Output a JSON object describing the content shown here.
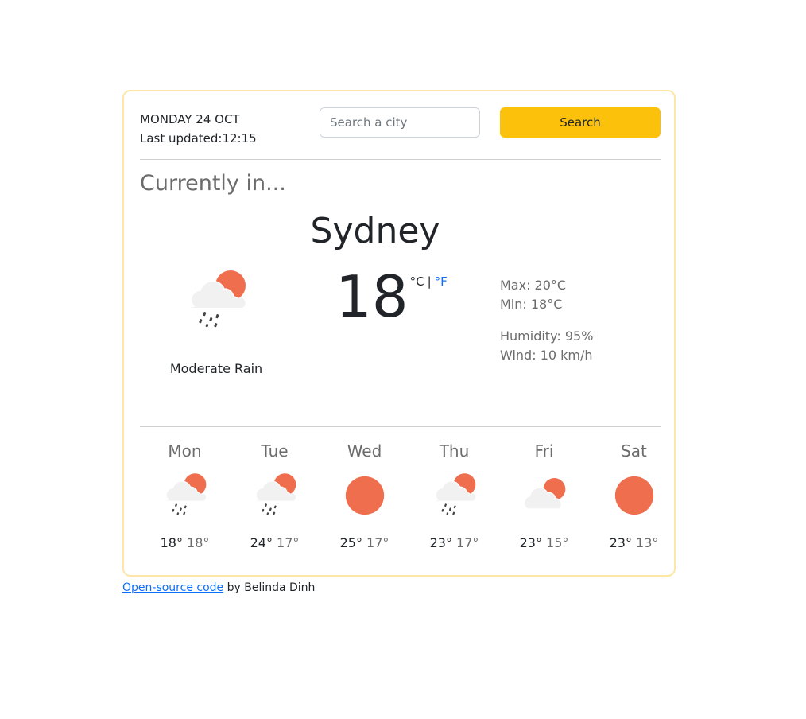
{
  "header": {
    "date": "MONDAY 24 OCT",
    "last_updated_label": "Last updated:",
    "last_updated_time": "12:15"
  },
  "search": {
    "placeholder": "Search a city",
    "value": "",
    "button_label": "Search"
  },
  "current": {
    "heading": "Currently in...",
    "city": "Sydney",
    "temperature": "18",
    "unit_celsius": "°C",
    "unit_separator": "|",
    "unit_fahrenheit": "°F",
    "condition": "Moderate Rain",
    "icon": "rain-sun-icon",
    "max": "Max: 20°C",
    "min": "Min: 18°C",
    "humidity": "Humidity: 95%",
    "wind": "Wind: 10 km/h"
  },
  "forecast": [
    {
      "day": "Mon",
      "icon": "rain",
      "high": "18°",
      "low": "18°"
    },
    {
      "day": "Tue",
      "icon": "rain",
      "high": "24°",
      "low": "17°"
    },
    {
      "day": "Wed",
      "icon": "sun",
      "high": "25°",
      "low": "17°"
    },
    {
      "day": "Thu",
      "icon": "rain",
      "high": "23°",
      "low": "17°"
    },
    {
      "day": "Fri",
      "icon": "cloud",
      "high": "23°",
      "low": "15°"
    },
    {
      "day": "Sat",
      "icon": "sun",
      "high": "23°",
      "low": "13°"
    }
  ],
  "footer": {
    "link_text": "Open-source code",
    "by_text": " by Belinda Dinh"
  },
  "colors": {
    "accent": "#fcc10a",
    "card_border": "#fde7a6",
    "sun": "#ee6e4d",
    "cloud": "#f1f1f1",
    "link": "#0d6efd"
  }
}
